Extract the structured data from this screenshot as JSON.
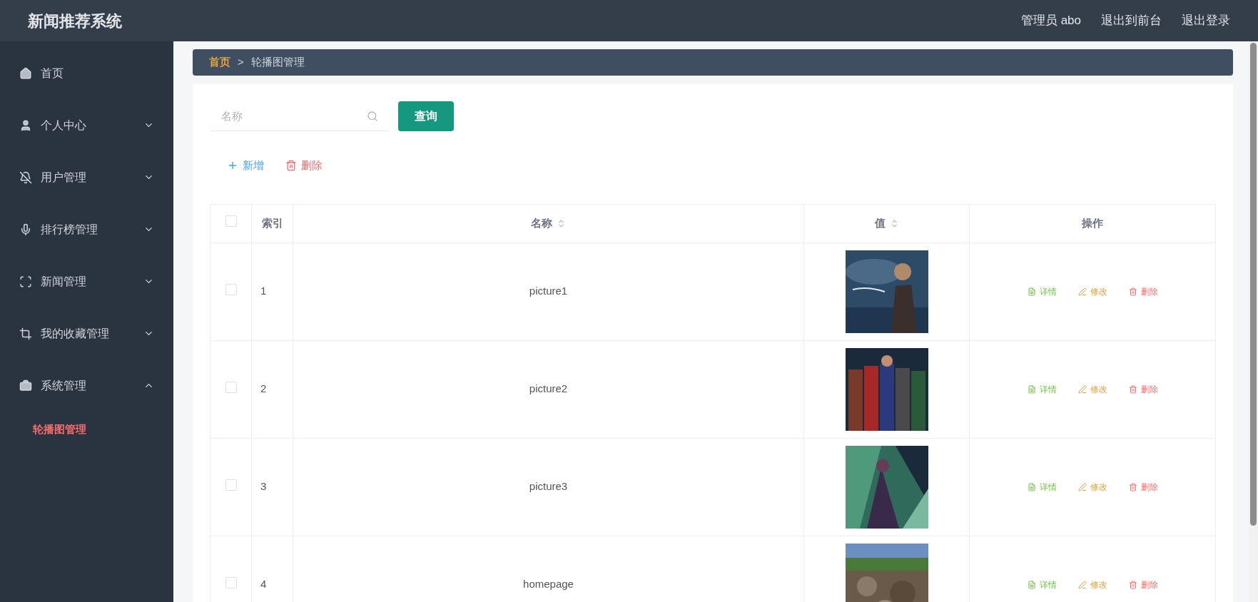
{
  "header": {
    "title": "新闻推荐系统",
    "links": [
      "管理员 abo",
      "退出到前台",
      "退出登录"
    ]
  },
  "sidebar": {
    "items": [
      {
        "label": "首页",
        "expandable": false
      },
      {
        "label": "个人中心",
        "expandable": true,
        "expanded": false
      },
      {
        "label": "用户管理",
        "expandable": true,
        "expanded": false
      },
      {
        "label": "排行榜管理",
        "expandable": true,
        "expanded": false
      },
      {
        "label": "新闻管理",
        "expandable": true,
        "expanded": false
      },
      {
        "label": "我的收藏管理",
        "expandable": true,
        "expanded": false
      },
      {
        "label": "系统管理",
        "expandable": true,
        "expanded": true,
        "children": [
          {
            "label": "轮播图管理",
            "selected": true
          }
        ]
      }
    ]
  },
  "breadcrumb": [
    "首页",
    "轮播图管理"
  ],
  "breadcrumb_separator": ">",
  "search": {
    "placeholder": "名称",
    "button": "查询"
  },
  "toolbar": [
    {
      "kind": "add",
      "label": "新增"
    },
    {
      "kind": "delete",
      "label": "删除"
    }
  ],
  "table": {
    "columns": [
      {
        "kind": "checkbox",
        "checked": false
      },
      {
        "kind": "text",
        "label": "索引",
        "sortable": false
      },
      {
        "kind": "text",
        "label": "名称",
        "sortable": true
      },
      {
        "kind": "text",
        "label": "值",
        "sortable": true
      },
      {
        "kind": "text",
        "label": "操作",
        "sortable": false
      }
    ],
    "rows": [
      {
        "checked": false,
        "index": "1",
        "name": "picture1",
        "value": {
          "kind": "picture"
        },
        "actions": [
          {
            "kind": "detail",
            "label": "详情"
          },
          {
            "kind": "edit",
            "label": "修改"
          },
          {
            "kind": "delete",
            "label": "删除"
          }
        ]
      },
      {
        "checked": false,
        "index": "2",
        "name": "picture2",
        "value": {
          "kind": "picture"
        },
        "actions": [
          {
            "kind": "detail",
            "label": "详情"
          },
          {
            "kind": "edit",
            "label": "修改"
          },
          {
            "kind": "delete",
            "label": "删除"
          }
        ]
      },
      {
        "checked": false,
        "index": "3",
        "name": "picture3",
        "value": {
          "kind": "picture"
        },
        "actions": [
          {
            "kind": "detail",
            "label": "详情"
          },
          {
            "kind": "edit",
            "label": "修改"
          },
          {
            "kind": "delete",
            "label": "删除"
          }
        ]
      },
      {
        "checked": false,
        "index": "4",
        "name": "homepage",
        "value": {
          "kind": "picture"
        },
        "actions": [
          {
            "kind": "detail",
            "label": "详情"
          },
          {
            "kind": "edit",
            "label": "修改"
          },
          {
            "kind": "delete",
            "label": "删除"
          }
        ]
      }
    ]
  }
}
